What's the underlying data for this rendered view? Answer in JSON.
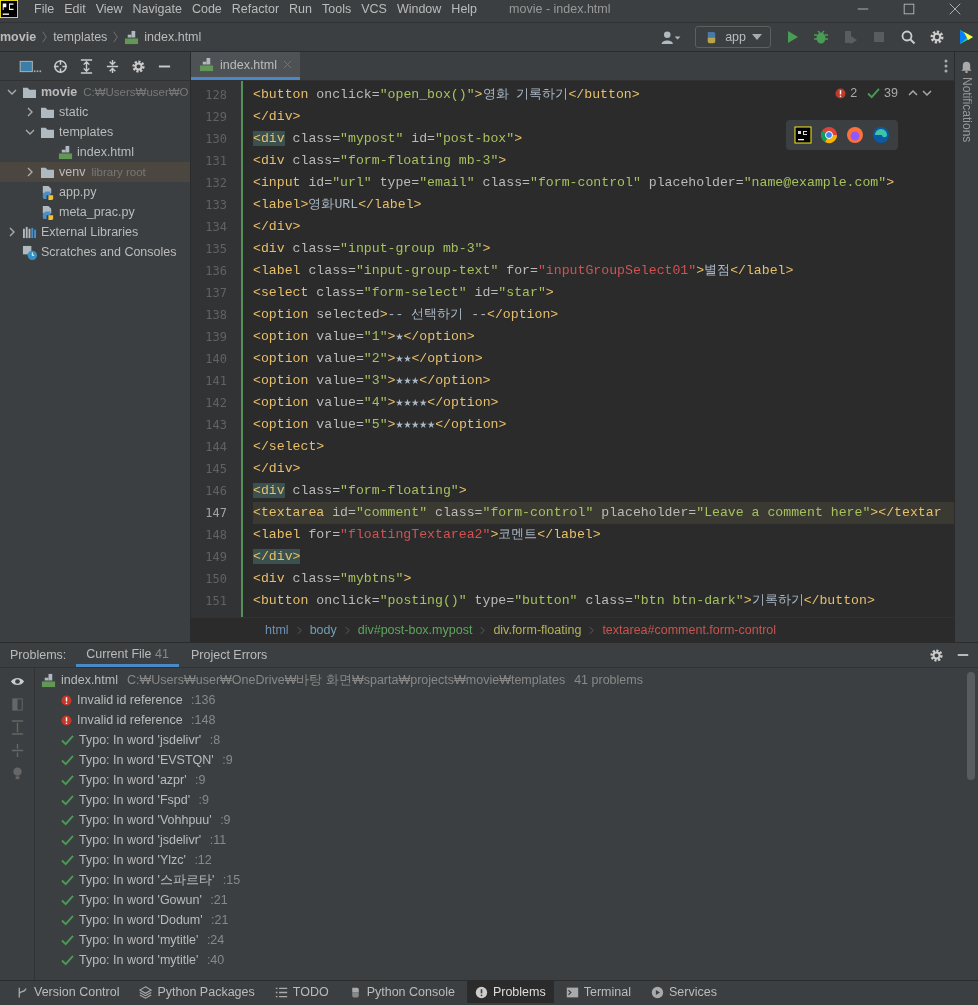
{
  "menu_bar": {
    "items": [
      "File",
      "Edit",
      "View",
      "Navigate",
      "Code",
      "Refactor",
      "Run",
      "Tools",
      "VCS",
      "Window",
      "Help"
    ],
    "title": "movie - index.html"
  },
  "nav_bar": {
    "crumbs": [
      "movie",
      "templates",
      "index.html"
    ],
    "run_config": "app"
  },
  "project_tree": [
    {
      "label": "movie",
      "hint": "C:₩Users₩user₩O",
      "kind": "folder",
      "expanded": true,
      "selected": false,
      "children": [
        {
          "label": "static",
          "kind": "folder",
          "expanded": false,
          "selected": false
        },
        {
          "label": "templates",
          "kind": "folder",
          "expanded": true,
          "selected": false,
          "children": [
            {
              "label": "index.html",
              "kind": "html",
              "selected": false
            }
          ]
        },
        {
          "label": "venv",
          "hint": "library root",
          "kind": "folder",
          "expanded": false,
          "selected": true
        },
        {
          "label": "app.py",
          "kind": "python",
          "selected": false
        },
        {
          "label": "meta_prac.py",
          "kind": "python",
          "selected": false
        }
      ]
    },
    {
      "label": "External Libraries",
      "kind": "libraries",
      "expanded": false,
      "selected": false
    },
    {
      "label": "Scratches and Consoles",
      "kind": "scratches",
      "selected": false
    }
  ],
  "editor_tabs": [
    {
      "label": "index.html",
      "selected": true
    }
  ],
  "inspection": {
    "errors": "2",
    "warnings": "39"
  },
  "code_lines": [
    {
      "number": "128",
      "current": false,
      "tokens": [
        {
          "kind": "tag",
          "text": "<button"
        },
        {
          "kind": "attr",
          "text": " onclick="
        },
        {
          "kind": "str",
          "text": "\"open_box()\""
        },
        {
          "kind": "tag",
          "text": ">"
        },
        {
          "kind": "text",
          "text": "영화 기록하기"
        },
        {
          "kind": "tag",
          "text": "</button>"
        }
      ]
    },
    {
      "number": "129",
      "current": false,
      "tokens": [
        {
          "kind": "tag",
          "text": "</div>"
        }
      ]
    },
    {
      "number": "130",
      "current": false,
      "tokens": [
        {
          "kind": "taghl",
          "text": "<div"
        },
        {
          "kind": "attr",
          "text": " class="
        },
        {
          "kind": "str",
          "text": "\"mypost\""
        },
        {
          "kind": "attr",
          "text": " id="
        },
        {
          "kind": "str",
          "text": "\"post-box\""
        },
        {
          "kind": "tag",
          "text": ">"
        }
      ]
    },
    {
      "number": "131",
      "current": false,
      "tokens": [
        {
          "kind": "tag",
          "text": "<div"
        },
        {
          "kind": "attr",
          "text": " class="
        },
        {
          "kind": "str",
          "text": "\"form-floating mb-3\""
        },
        {
          "kind": "tag",
          "text": ">"
        }
      ]
    },
    {
      "number": "132",
      "current": false,
      "tokens": [
        {
          "kind": "tag",
          "text": "<input"
        },
        {
          "kind": "attr",
          "text": " id="
        },
        {
          "kind": "str",
          "text": "\"url\""
        },
        {
          "kind": "attr",
          "text": " type="
        },
        {
          "kind": "str",
          "text": "\"email\""
        },
        {
          "kind": "attr",
          "text": " class="
        },
        {
          "kind": "str",
          "text": "\"form-control\""
        },
        {
          "kind": "attr",
          "text": " placeholder="
        },
        {
          "kind": "str",
          "text": "\"name@example.com\""
        },
        {
          "kind": "tag",
          "text": ">"
        }
      ]
    },
    {
      "number": "133",
      "current": false,
      "tokens": [
        {
          "kind": "tag",
          "text": "<label>"
        },
        {
          "kind": "text",
          "text": "영화URL"
        },
        {
          "kind": "tag",
          "text": "</label>"
        }
      ]
    },
    {
      "number": "134",
      "current": false,
      "tokens": [
        {
          "kind": "tag",
          "text": "</div>"
        }
      ]
    },
    {
      "number": "135",
      "current": false,
      "tokens": [
        {
          "kind": "tag",
          "text": "<div"
        },
        {
          "kind": "attr",
          "text": " class="
        },
        {
          "kind": "str",
          "text": "\"input-group mb-3\""
        },
        {
          "kind": "tag",
          "text": ">"
        }
      ]
    },
    {
      "number": "136",
      "current": false,
      "tokens": [
        {
          "kind": "tag",
          "text": "<label"
        },
        {
          "kind": "attr",
          "text": " class="
        },
        {
          "kind": "str",
          "text": "\"input-group-text\""
        },
        {
          "kind": "attr",
          "text": " for="
        },
        {
          "kind": "bad",
          "text": "\"inputGroupSelect01\""
        },
        {
          "kind": "tag",
          "text": ">"
        },
        {
          "kind": "text",
          "text": "별점"
        },
        {
          "kind": "tag",
          "text": "</label>"
        }
      ]
    },
    {
      "number": "137",
      "current": false,
      "tokens": [
        {
          "kind": "tag",
          "text": "<select"
        },
        {
          "kind": "attr",
          "text": " class="
        },
        {
          "kind": "str",
          "text": "\"form-select\""
        },
        {
          "kind": "attr",
          "text": " id="
        },
        {
          "kind": "str",
          "text": "\"star\""
        },
        {
          "kind": "tag",
          "text": ">"
        }
      ]
    },
    {
      "number": "138",
      "current": false,
      "tokens": [
        {
          "kind": "tag",
          "text": "<option"
        },
        {
          "kind": "attr",
          "text": " selected"
        },
        {
          "kind": "tag",
          "text": ">"
        },
        {
          "kind": "text",
          "text": "-- 선택하기 --"
        },
        {
          "kind": "tag",
          "text": "</option>"
        }
      ]
    },
    {
      "number": "139",
      "current": false,
      "tokens": [
        {
          "kind": "tag",
          "text": "<option"
        },
        {
          "kind": "attr",
          "text": " value="
        },
        {
          "kind": "str",
          "text": "\"1\""
        },
        {
          "kind": "tag",
          "text": ">"
        },
        {
          "kind": "text",
          "text": "★"
        },
        {
          "kind": "tag",
          "text": "</option>"
        }
      ]
    },
    {
      "number": "140",
      "current": false,
      "tokens": [
        {
          "kind": "tag",
          "text": "<option"
        },
        {
          "kind": "attr",
          "text": " value="
        },
        {
          "kind": "str",
          "text": "\"2\""
        },
        {
          "kind": "tag",
          "text": ">"
        },
        {
          "kind": "text",
          "text": "★★"
        },
        {
          "kind": "tag",
          "text": "</option>"
        }
      ]
    },
    {
      "number": "141",
      "current": false,
      "tokens": [
        {
          "kind": "tag",
          "text": "<option"
        },
        {
          "kind": "attr",
          "text": " value="
        },
        {
          "kind": "str",
          "text": "\"3\""
        },
        {
          "kind": "tag",
          "text": ">"
        },
        {
          "kind": "text",
          "text": "★★★"
        },
        {
          "kind": "tag",
          "text": "</option>"
        }
      ]
    },
    {
      "number": "142",
      "current": false,
      "tokens": [
        {
          "kind": "tag",
          "text": "<option"
        },
        {
          "kind": "attr",
          "text": " value="
        },
        {
          "kind": "str",
          "text": "\"4\""
        },
        {
          "kind": "tag",
          "text": ">"
        },
        {
          "kind": "text",
          "text": "★★★★"
        },
        {
          "kind": "tag",
          "text": "</option>"
        }
      ]
    },
    {
      "number": "143",
      "current": false,
      "tokens": [
        {
          "kind": "tag",
          "text": "<option"
        },
        {
          "kind": "attr",
          "text": " value="
        },
        {
          "kind": "str",
          "text": "\"5\""
        },
        {
          "kind": "tag",
          "text": ">"
        },
        {
          "kind": "text",
          "text": "★★★★★"
        },
        {
          "kind": "tag",
          "text": "</option>"
        }
      ]
    },
    {
      "number": "144",
      "current": false,
      "tokens": [
        {
          "kind": "tag",
          "text": "</select>"
        }
      ]
    },
    {
      "number": "145",
      "current": false,
      "tokens": [
        {
          "kind": "tag",
          "text": "</div>"
        }
      ]
    },
    {
      "number": "146",
      "current": false,
      "tokens": [
        {
          "kind": "taghl",
          "text": "<div"
        },
        {
          "kind": "attr",
          "text": " class="
        },
        {
          "kind": "str",
          "text": "\"form-floating\""
        },
        {
          "kind": "tag",
          "text": ">"
        }
      ]
    },
    {
      "number": "147",
      "current": true,
      "tokens": [
        {
          "kind": "tag",
          "text": "<textarea"
        },
        {
          "kind": "attr",
          "text": " id="
        },
        {
          "kind": "str",
          "text": "\"comment\""
        },
        {
          "kind": "attr",
          "text": " class="
        },
        {
          "kind": "str",
          "text": "\"form-control\""
        },
        {
          "kind": "attr",
          "text": " placeholder="
        },
        {
          "kind": "str",
          "text": "\"Leave a comment here\""
        },
        {
          "kind": "tag",
          "text": "></textar"
        }
      ]
    },
    {
      "number": "148",
      "current": false,
      "tokens": [
        {
          "kind": "tag",
          "text": "<label"
        },
        {
          "kind": "attr",
          "text": " for="
        },
        {
          "kind": "bad",
          "text": "\"floatingTextarea2\""
        },
        {
          "kind": "tag",
          "text": ">"
        },
        {
          "kind": "text",
          "text": "코멘트"
        },
        {
          "kind": "tag",
          "text": "</label>"
        }
      ]
    },
    {
      "number": "149",
      "current": false,
      "tokens": [
        {
          "kind": "taghl",
          "text": "</div>"
        }
      ]
    },
    {
      "number": "150",
      "current": false,
      "tokens": [
        {
          "kind": "tag",
          "text": "<div"
        },
        {
          "kind": "attr",
          "text": " class="
        },
        {
          "kind": "str",
          "text": "\"mybtns\""
        },
        {
          "kind": "tag",
          "text": ">"
        }
      ]
    },
    {
      "number": "151",
      "current": false,
      "tokens": [
        {
          "kind": "tag",
          "text": "<button"
        },
        {
          "kind": "attr",
          "text": " onclick="
        },
        {
          "kind": "str",
          "text": "\"posting()\""
        },
        {
          "kind": "attr",
          "text": " type="
        },
        {
          "kind": "str",
          "text": "\"button\""
        },
        {
          "kind": "attr",
          "text": " class="
        },
        {
          "kind": "str",
          "text": "\"btn btn-dark\""
        },
        {
          "kind": "tag",
          "text": ">"
        },
        {
          "kind": "text",
          "text": "기록하기"
        },
        {
          "kind": "tag",
          "text": "</button>"
        }
      ]
    }
  ],
  "breadcrumbs": [
    {
      "label": "html",
      "color": "#6e90b5"
    },
    {
      "label": "body",
      "color": "#6e9fb5"
    },
    {
      "label": "div#post-box.mypost",
      "color": "#5ea65e"
    },
    {
      "label": "div.form-floating",
      "color": "#b5b05c"
    },
    {
      "label": "textarea#comment.form-control",
      "color": "#c75450"
    }
  ],
  "right_stripe": {
    "label": "Notifications"
  },
  "problems": {
    "label": "Problems:",
    "tabs": [
      {
        "label": "Current File",
        "count": "41",
        "selected": true
      },
      {
        "label": "Project Errors",
        "selected": false
      }
    ],
    "file": {
      "name": "index.html",
      "path": "C:₩Users₩user₩OneDrive₩바탕 화면₩sparta₩projects₩movie₩templates",
      "count": "41 problems"
    },
    "items": [
      {
        "kind": "error",
        "text": "Invalid id reference",
        "line": ":136"
      },
      {
        "kind": "error",
        "text": "Invalid id reference",
        "line": ":148"
      },
      {
        "kind": "typo",
        "text": "Typo: In word 'jsdelivr'",
        "line": ":8"
      },
      {
        "kind": "typo",
        "text": "Typo: In word 'EVSTQN'",
        "line": ":9"
      },
      {
        "kind": "typo",
        "text": "Typo: In word 'azpr'",
        "line": ":9"
      },
      {
        "kind": "typo",
        "text": "Typo: In word 'Fspd'",
        "line": ":9"
      },
      {
        "kind": "typo",
        "text": "Typo: In word 'Vohhpuu'",
        "line": ":9"
      },
      {
        "kind": "typo",
        "text": "Typo: In word 'jsdelivr'",
        "line": ":11"
      },
      {
        "kind": "typo",
        "text": "Typo: In word 'Ylzc'",
        "line": ":12"
      },
      {
        "kind": "typo",
        "text": "Typo: In word '스파르타'",
        "line": ":15"
      },
      {
        "kind": "typo",
        "text": "Typo: In word 'Gowun'",
        "line": ":21"
      },
      {
        "kind": "typo",
        "text": "Typo: In word 'Dodum'",
        "line": ":21"
      },
      {
        "kind": "typo",
        "text": "Typo: In word 'mytitle'",
        "line": ":24"
      },
      {
        "kind": "typo",
        "text": "Typo: In word 'mytitle'",
        "line": ":40"
      }
    ]
  },
  "tool_windows": [
    {
      "label": "Version Control",
      "kind": "vcs",
      "selected": false
    },
    {
      "label": "Python Packages",
      "kind": "packages",
      "selected": false
    },
    {
      "label": "TODO",
      "kind": "todo",
      "selected": false
    },
    {
      "label": "Python Console",
      "kind": "console",
      "selected": false
    },
    {
      "label": "Problems",
      "kind": "problems",
      "selected": true
    },
    {
      "label": "Terminal",
      "kind": "terminal",
      "selected": false
    },
    {
      "label": "Services",
      "kind": "services",
      "selected": false
    }
  ]
}
